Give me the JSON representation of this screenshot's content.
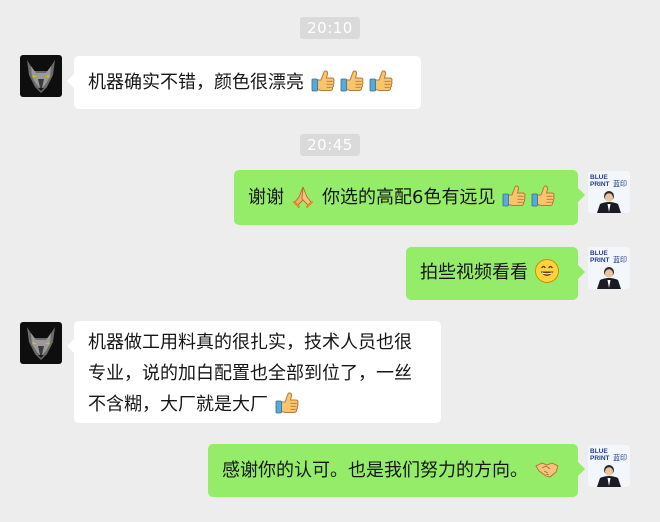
{
  "timestamps": [
    "20:10",
    "20:45"
  ],
  "messages": [
    {
      "sender": "customer",
      "text": "机器确实不错，颜色很漂亮",
      "emojis": [
        "thumbs-up-icon",
        "thumbs-up-icon",
        "thumbs-up-icon"
      ]
    },
    {
      "sender": "company",
      "text_before": "谢谢",
      "mid_emoji": "folded-hands-icon",
      "text": "你选的高配6色有远见",
      "emojis": [
        "thumbs-up-icon",
        "thumbs-up-icon"
      ]
    },
    {
      "sender": "company",
      "text": "拍些视频看看",
      "emojis": [
        "grinning-face-icon"
      ]
    },
    {
      "sender": "customer",
      "text": "机器做工用料真的很扎实，技术人员也很专业，说的加白配置也全部到位了，一丝不含糊，大厂就是大厂",
      "emojis": [
        "thumbs-up-icon"
      ]
    },
    {
      "sender": "company",
      "text": "感谢你的认可。也是我们努力的方向。",
      "emojis": [
        "handshake-icon"
      ]
    }
  ],
  "avatars": {
    "customer": "wolf-avatar",
    "company": {
      "logo_line1": "BLUE",
      "logo_line2": "PRINT",
      "logo_cn": "蓝印"
    }
  },
  "colors": {
    "background": "#ededed",
    "outgoing_bubble": "#95ec69",
    "incoming_bubble": "#ffffff",
    "timestamp_pill": "#dadada"
  }
}
